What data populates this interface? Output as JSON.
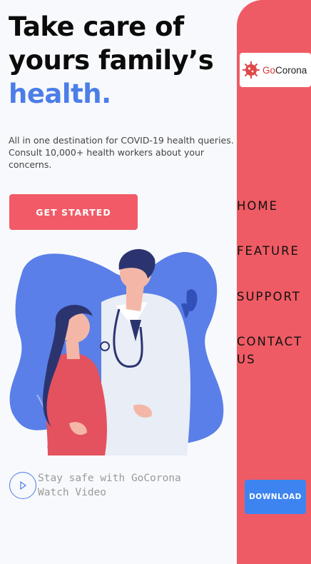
{
  "hero": {
    "title_line1": "Take care of",
    "title_line2": "yours family’s",
    "title_accent": "health.",
    "description": "All in one destination for COVID-19 health queries. Consult 10,000+ health workers about your concerns.",
    "cta_label": "GET STARTED"
  },
  "watch": {
    "line1": "Stay safe with GoCorona",
    "line2": "Watch Video"
  },
  "brand": {
    "name_prefix": "Go",
    "name_suffix": "Corona",
    "logo_icon": "virus-icon"
  },
  "nav": {
    "home": "HOME",
    "feature": "FEATURE",
    "support": "SUPPORT",
    "contact_line1": "CONTACT",
    "contact_line2": "US"
  },
  "download_label": "DOWNLOAD",
  "colors": {
    "accent_red": "#ef5b64",
    "accent_blue": "#4c7ee8",
    "download_blue": "#3d84f0",
    "background": "#f8f9fc"
  }
}
